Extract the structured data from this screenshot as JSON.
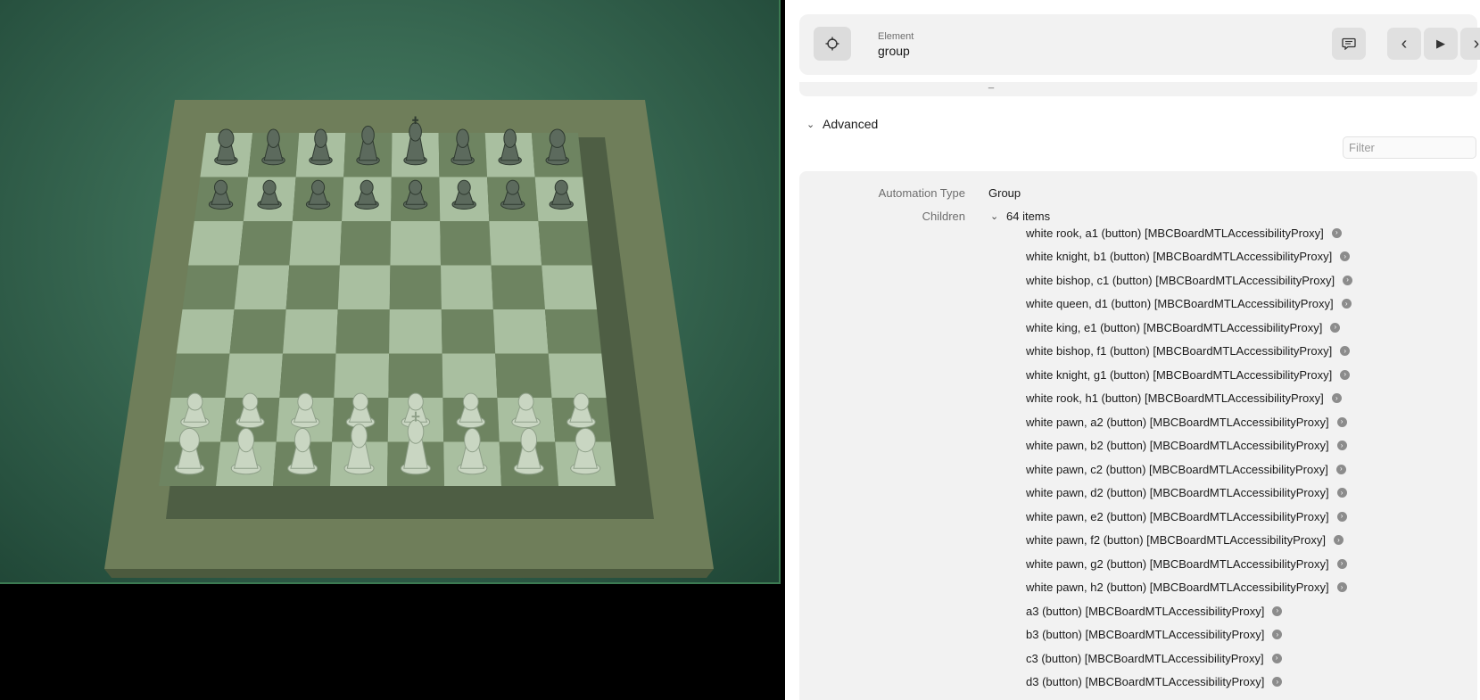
{
  "header": {
    "kicker": "Element",
    "element_name": "group",
    "target_icon": "crosshair-icon",
    "buttons": [
      {
        "name": "comment-button",
        "icon": "speech-bubble-icon",
        "glyph": "▤"
      },
      {
        "name": "back-button",
        "icon": "chevron-left-icon",
        "glyph": "‹"
      },
      {
        "name": "play-button",
        "icon": "play-icon",
        "glyph": "▶"
      },
      {
        "name": "forward-button",
        "icon": "chevron-right-icon",
        "glyph": "›"
      }
    ]
  },
  "prev_section_mark": "_",
  "advanced": {
    "label": "Advanced",
    "filter_placeholder": "Filter"
  },
  "properties": {
    "automation_type_label": "Automation Type",
    "automation_type_value": "Group",
    "children_label": "Children",
    "children_count": "64 items"
  },
  "children": [
    "white rook, a1 (button) [MBCBoardMTLAccessibilityProxy]",
    "white knight, b1 (button) [MBCBoardMTLAccessibilityProxy]",
    "white bishop, c1 (button) [MBCBoardMTLAccessibilityProxy]",
    "white queen, d1 (button) [MBCBoardMTLAccessibilityProxy]",
    "white king, e1 (button) [MBCBoardMTLAccessibilityProxy]",
    "white bishop, f1 (button) [MBCBoardMTLAccessibilityProxy]",
    "white knight, g1 (button) [MBCBoardMTLAccessibilityProxy]",
    "white rook, h1 (button) [MBCBoardMTLAccessibilityProxy]",
    "white pawn, a2 (button) [MBCBoardMTLAccessibilityProxy]",
    "white pawn, b2 (button) [MBCBoardMTLAccessibilityProxy]",
    "white pawn, c2 (button) [MBCBoardMTLAccessibilityProxy]",
    "white pawn, d2 (button) [MBCBoardMTLAccessibilityProxy]",
    "white pawn, e2 (button) [MBCBoardMTLAccessibilityProxy]",
    "white pawn, f2 (button) [MBCBoardMTLAccessibilityProxy]",
    "white pawn, g2 (button) [MBCBoardMTLAccessibilityProxy]",
    "white pawn, h2 (button) [MBCBoardMTLAccessibilityProxy]",
    "a3 (button) [MBCBoardMTLAccessibilityProxy]",
    "b3 (button) [MBCBoardMTLAccessibilityProxy]",
    "c3 (button) [MBCBoardMTLAccessibilityProxy]",
    "d3 (button) [MBCBoardMTLAccessibilityProxy]"
  ],
  "board": {
    "black_back_rank": [
      "rook",
      "knight",
      "bishop",
      "queen",
      "king",
      "bishop",
      "knight",
      "rook"
    ],
    "white_back_rank": [
      "rook",
      "knight",
      "bishop",
      "queen",
      "king",
      "bishop",
      "knight",
      "rook"
    ],
    "colors": {
      "background": "#3a6b54",
      "frame": "#6f7e5a",
      "light_square": "#a9bfa0",
      "dark_square": "#6e8461",
      "white_piece": "#c9d6c2",
      "black_piece": "#5c6a5d"
    }
  }
}
